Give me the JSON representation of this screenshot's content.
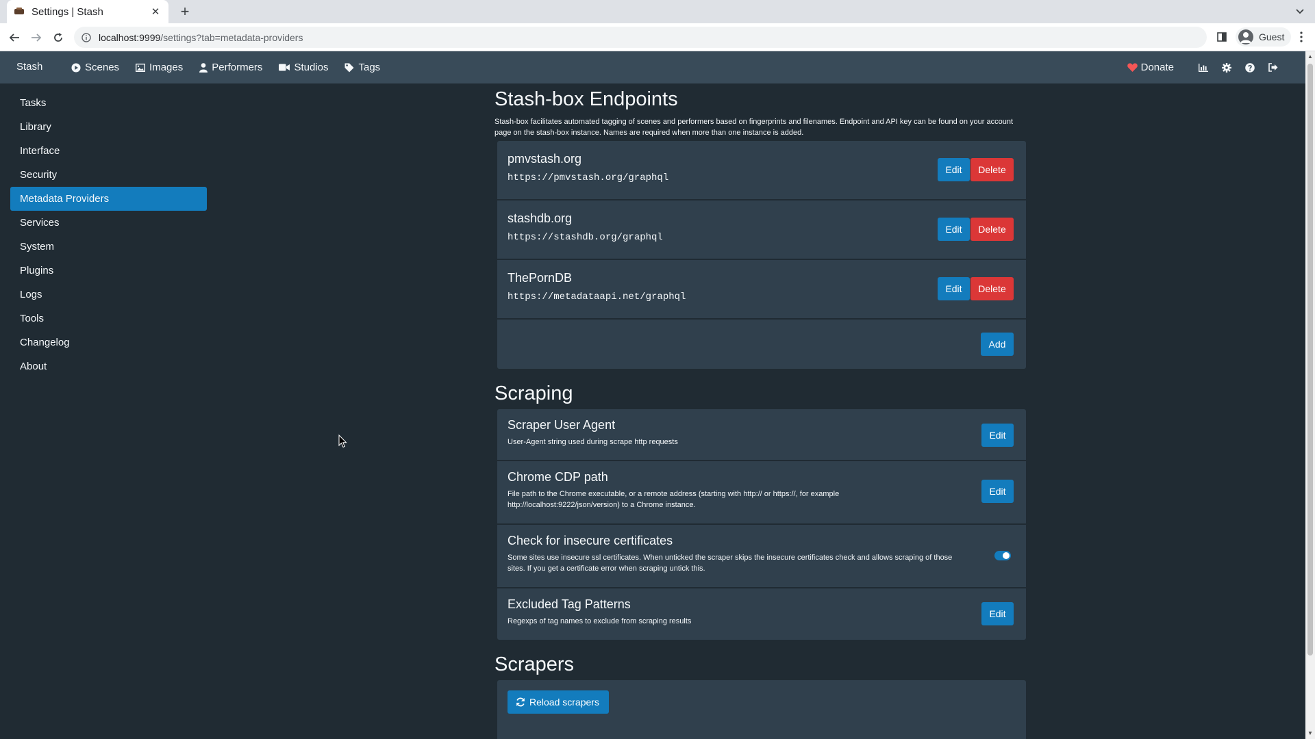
{
  "browser": {
    "tab_title": "Settings | Stash",
    "url_host": "localhost:9999",
    "url_path": "/settings?tab=metadata-providers",
    "profile": "Guest"
  },
  "appnav": {
    "brand": "Stash",
    "links": [
      {
        "label": "Scenes",
        "icon": "play-circle-icon"
      },
      {
        "label": "Images",
        "icon": "image-icon"
      },
      {
        "label": "Performers",
        "icon": "user-icon"
      },
      {
        "label": "Studios",
        "icon": "video-camera-icon"
      },
      {
        "label": "Tags",
        "icon": "tag-icon"
      }
    ],
    "donate": "Donate"
  },
  "sidebar": {
    "items": [
      {
        "label": "Tasks"
      },
      {
        "label": "Library"
      },
      {
        "label": "Interface"
      },
      {
        "label": "Security"
      },
      {
        "label": "Metadata Providers",
        "active": true
      },
      {
        "label": "Services"
      },
      {
        "label": "System"
      },
      {
        "label": "Plugins"
      },
      {
        "label": "Logs"
      },
      {
        "label": "Tools"
      },
      {
        "label": "Changelog"
      },
      {
        "label": "About"
      }
    ]
  },
  "stashbox": {
    "title": "Stash-box Endpoints",
    "description": "Stash-box facilitates automated tagging of scenes and performers based on fingerprints and filenames. Endpoint and API key can be found on your account page on the stash-box instance. Names are required when more than one instance is added.",
    "endpoints": [
      {
        "name": "pmvstash.org",
        "url": "https://pmvstash.org/graphql"
      },
      {
        "name": "stashdb.org",
        "url": "https://stashdb.org/graphql"
      },
      {
        "name": "ThePornDB",
        "url": "https://metadataapi.net/graphql"
      }
    ],
    "edit_label": "Edit",
    "delete_label": "Delete",
    "add_label": "Add"
  },
  "scraping": {
    "title": "Scraping",
    "items": [
      {
        "name": "Scraper User Agent",
        "desc": "User-Agent string used during scrape http requests",
        "button": "Edit"
      },
      {
        "name": "Chrome CDP path",
        "desc": "File path to the Chrome executable, or a remote address (starting with http:// or https://, for example http://localhost:9222/json/version) to a Chrome instance.",
        "button": "Edit"
      },
      {
        "name": "Check for insecure certificates",
        "desc": "Some sites use insecure ssl certificates. When unticked the scraper skips the insecure certificates check and allows scraping of those sites. If you get a certificate error when scraping untick this.",
        "toggle": true
      },
      {
        "name": "Excluded Tag Patterns",
        "desc": "Regexps of tag names to exclude from scraping results",
        "button": "Edit"
      }
    ]
  },
  "scrapers": {
    "title": "Scrapers",
    "reload_label": "Reload scrapers"
  },
  "colors": {
    "primary": "#137cbd",
    "danger": "#db3737",
    "background": "#202b33",
    "card": "#30404d",
    "navbar": "#394b59"
  }
}
